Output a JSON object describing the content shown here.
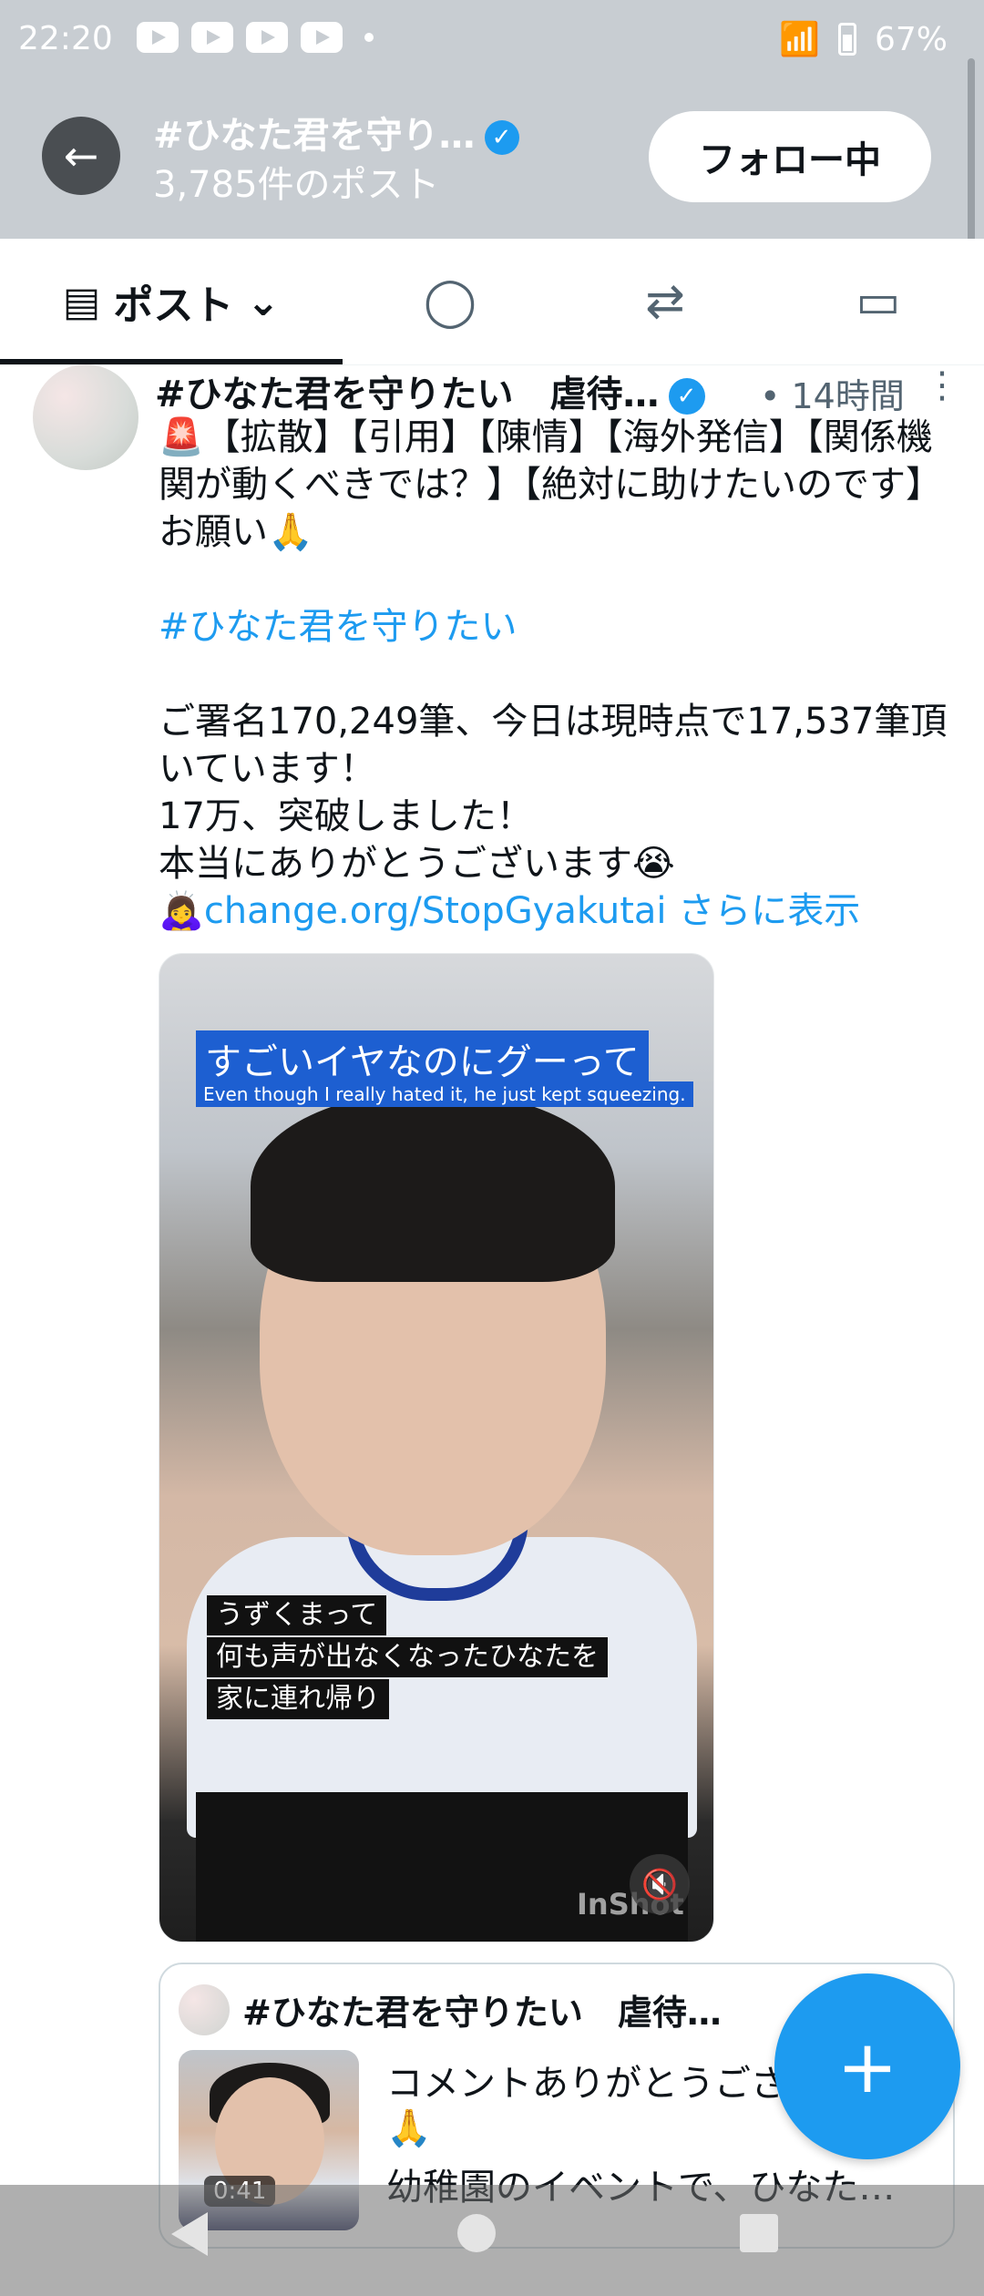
{
  "status_bar": {
    "time": "22:20",
    "battery": "67%"
  },
  "header": {
    "back_icon": "←",
    "title": "#ひなた君を守り…",
    "verified_icon": "✓",
    "subtitle": "3,785件のポスト",
    "follow_label": "フォロー中"
  },
  "tabs": {
    "posts_label": "ポスト",
    "posts_icon": "▤",
    "chevron": "⌄",
    "replies_icon": "◯",
    "reposts_icon": "⇄",
    "media_icon": "▭"
  },
  "post": {
    "author": "#ひなた君を守りたい　虐待…",
    "verified_icon": "✓",
    "time": "• 14時間",
    "more_icon": "⋮",
    "line1": "🚨【拡散】【引用】【陳情】【海外発信】【関係機関が動くべきでは？】【絶対に助けたいのです】お願い🙏",
    "hashtag": "#ひなた君を守りたい",
    "line2": "ご署名170,249筆、今日は現時点で17,537筆頂いています！\n17万、突破しました！\n本当にありがとうございます😭",
    "link_prefix": "🙇‍♀️",
    "link": "change.org/StopGyakutai",
    "show_more": "さらに表示",
    "media": {
      "caption_top": "すごいイヤなのにグーって",
      "caption_en": "Even though I really hated it, he just kept squeezing.",
      "caption_bottom_1": "うずくまって",
      "caption_bottom_2": "何も声が出なくなったひなたを",
      "caption_bottom_3": "家に連れ帰り",
      "mute_icon": "🔇",
      "watermark": "InShot"
    }
  },
  "quote": {
    "author": "#ひなた君を守りたい　虐待…",
    "duration": "0:41",
    "text1": "コメントありがとうござ",
    "emoji": "🙏",
    "text2": "幼稚園のイベントで、ひなた…"
  },
  "fab": {
    "icon": "+"
  }
}
